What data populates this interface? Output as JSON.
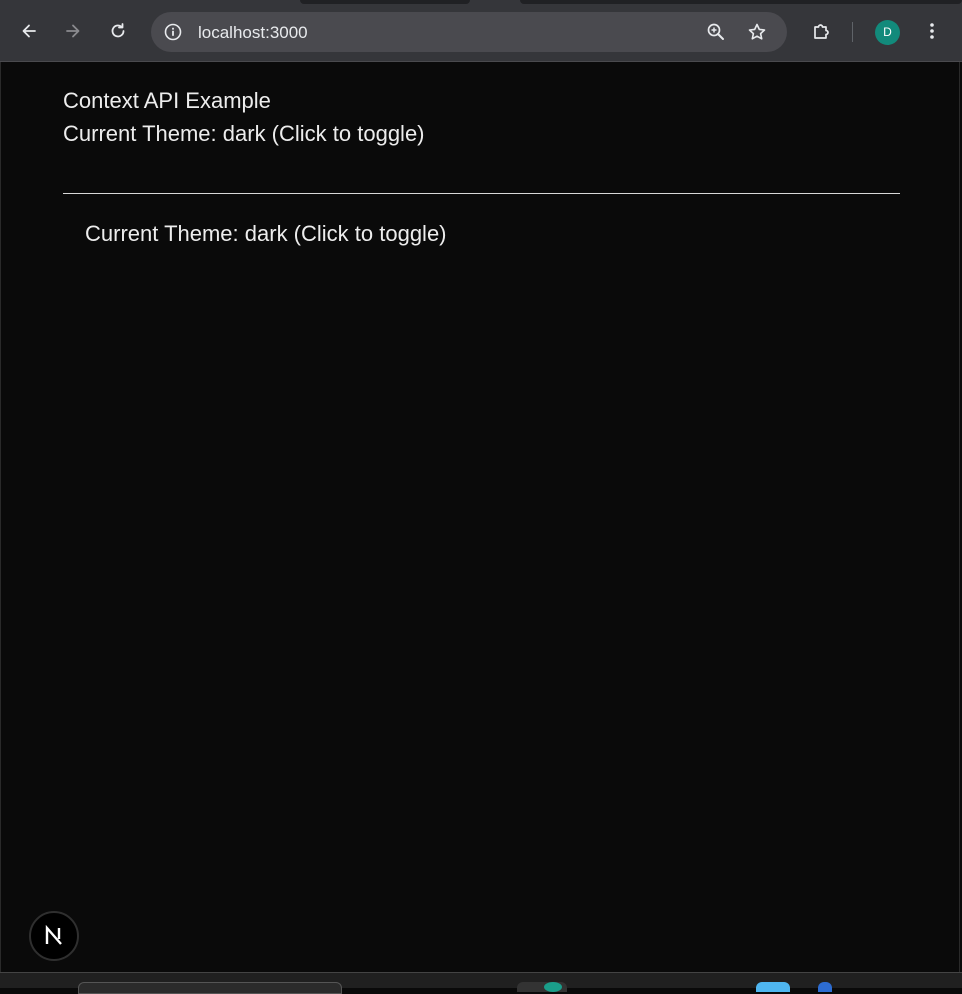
{
  "browser": {
    "url": "localhost:3000",
    "profile_initial": "D",
    "profile_color": "#128a7b",
    "icons": [
      "back-arrow-icon",
      "forward-arrow-icon",
      "reload-icon",
      "site-info-icon",
      "zoom-icon",
      "bookmark-star-icon",
      "extensions-icon",
      "more-vert-icon"
    ]
  },
  "page": {
    "heading": "Context API Example",
    "theme_toggle_label": "Current Theme: dark (Click to toggle)",
    "nested_theme_toggle_label": "Current Theme: dark (Click to toggle)",
    "background_color": "#0a0a0a",
    "text_color": "#ededed"
  },
  "dev_indicator": {
    "icon": "nextjs-logo-icon",
    "letter": "N"
  }
}
